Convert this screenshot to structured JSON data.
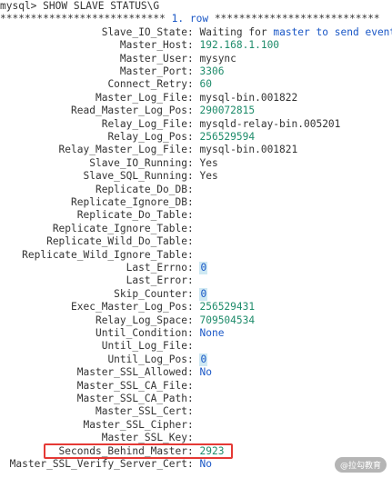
{
  "prompt": "mysql> ",
  "command": "SHOW SLAVE STATUS\\G",
  "row_header": {
    "stars_left": "***************************",
    "row_number": "1.",
    "row_word": "row",
    "stars_right": "***************************"
  },
  "fields": [
    {
      "key": "Slave_IO_State",
      "value": "Waiting for master to send event"
    },
    {
      "key": "Master_Host",
      "value": "192.168.1.100"
    },
    {
      "key": "Master_User",
      "value": "mysync"
    },
    {
      "key": "Master_Port",
      "value": "3306"
    },
    {
      "key": "Connect_Retry",
      "value": "60"
    },
    {
      "key": "Master_Log_File",
      "value": "mysql-bin.001822"
    },
    {
      "key": "Read_Master_Log_Pos",
      "value": "290072815"
    },
    {
      "key": "Relay_Log_File",
      "value": "mysqld-relay-bin.005201"
    },
    {
      "key": "Relay_Log_Pos",
      "value": "256529594"
    },
    {
      "key": "Relay_Master_Log_File",
      "value": "mysql-bin.001821"
    },
    {
      "key": "Slave_IO_Running",
      "value": "Yes"
    },
    {
      "key": "Slave_SQL_Running",
      "value": "Yes"
    },
    {
      "key": "Replicate_Do_DB",
      "value": ""
    },
    {
      "key": "Replicate_Ignore_DB",
      "value": ""
    },
    {
      "key": "Replicate_Do_Table",
      "value": ""
    },
    {
      "key": "Replicate_Ignore_Table",
      "value": ""
    },
    {
      "key": "Replicate_Wild_Do_Table",
      "value": ""
    },
    {
      "key": "Replicate_Wild_Ignore_Table",
      "value": ""
    },
    {
      "key": "Last_Errno",
      "value": "0"
    },
    {
      "key": "Last_Error",
      "value": ""
    },
    {
      "key": "Skip_Counter",
      "value": "0"
    },
    {
      "key": "Exec_Master_Log_Pos",
      "value": "256529431"
    },
    {
      "key": "Relay_Log_Space",
      "value": "709504534"
    },
    {
      "key": "Until_Condition",
      "value": "None"
    },
    {
      "key": "Until_Log_File",
      "value": ""
    },
    {
      "key": "Until_Log_Pos",
      "value": "0"
    },
    {
      "key": "Master_SSL_Allowed",
      "value": "No"
    },
    {
      "key": "Master_SSL_CA_File",
      "value": ""
    },
    {
      "key": "Master_SSL_CA_Path",
      "value": ""
    },
    {
      "key": "Master_SSL_Cert",
      "value": ""
    },
    {
      "key": "Master_SSL_Cipher",
      "value": ""
    },
    {
      "key": "Master_SSL_Key",
      "value": ""
    },
    {
      "key": "Seconds_Behind_Master",
      "value": "2923"
    },
    {
      "key": "Master_SSL_Verify_Server_Cert",
      "value": "No"
    }
  ],
  "highlighted_field": "Seconds_Behind_Master",
  "watermark": "@拉勾教育",
  "colors": {
    "highlight_border": "#e53935",
    "number": "#1f8c6b",
    "keyword": "#1a57c6"
  }
}
